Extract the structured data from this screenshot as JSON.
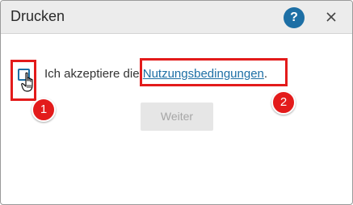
{
  "dialog": {
    "title": "Drucken",
    "help_label": "?",
    "close_icon": "close-icon"
  },
  "terms": {
    "text_before_link": "Ich akzeptiere die ",
    "link_label": "Nutzungsbedingungen",
    "text_after_link": ".",
    "checked": false
  },
  "actions": {
    "continue_label": "Weiter",
    "continue_enabled": false
  },
  "annotations": {
    "marker_1": "1",
    "marker_2": "2",
    "highlight_color": "#e31b1b"
  },
  "colors": {
    "accent": "#1d6fa5",
    "titlebar": "#ececec",
    "disabled_button": "#e6e6e6"
  }
}
